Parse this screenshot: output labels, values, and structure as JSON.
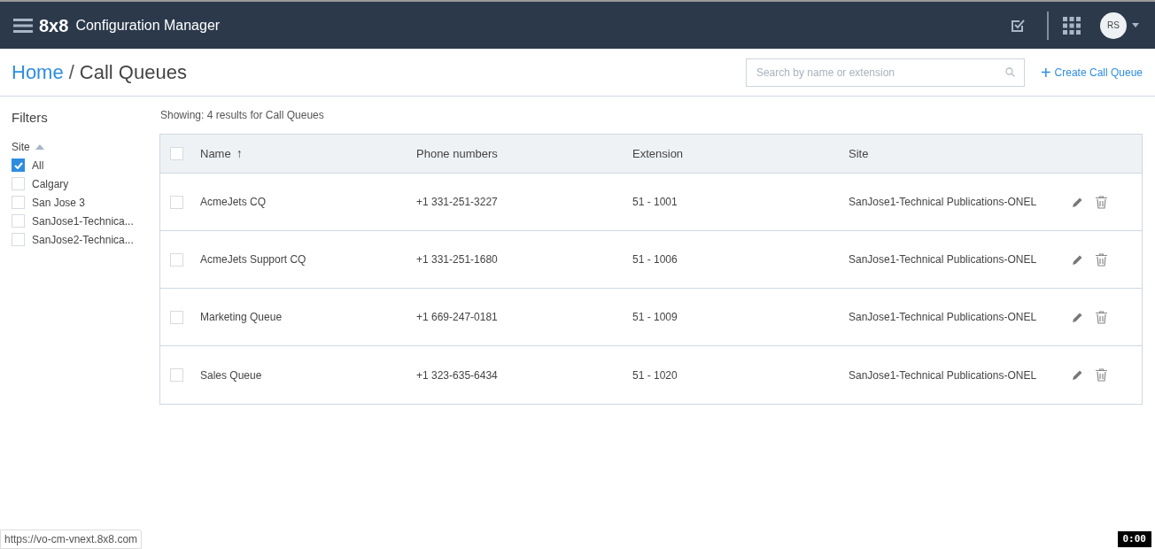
{
  "header": {
    "logo": "8x8",
    "app_title": "Configuration Manager",
    "avatar_initials": "RS"
  },
  "breadcrumb": {
    "home": "Home",
    "separator": "/",
    "current": "Call Queues"
  },
  "search": {
    "placeholder": "Search by name or extension"
  },
  "create_button": {
    "icon": "+",
    "label": "Create Call Queue"
  },
  "filters": {
    "title": "Filters",
    "group": "Site",
    "expanded": true,
    "items": [
      {
        "label": "All",
        "checked": true
      },
      {
        "label": "Calgary",
        "checked": false
      },
      {
        "label": "San Jose 3",
        "checked": false
      },
      {
        "label": "SanJose1-Technica...",
        "checked": false
      },
      {
        "label": "SanJose2-Technica...",
        "checked": false
      }
    ]
  },
  "results_summary": "Showing: 4 results for Call Queues",
  "table": {
    "select_all_checked": false,
    "columns": [
      {
        "label": "Name",
        "sort": "↑"
      },
      {
        "label": "Phone numbers"
      },
      {
        "label": "Extension"
      },
      {
        "label": "Site"
      }
    ],
    "rows": [
      {
        "checked": false,
        "cells": [
          "AcmeJets CQ",
          "+1 331-251-3227",
          "51 - 1001",
          "SanJose1-Technical Publications-ONEL"
        ]
      },
      {
        "checked": false,
        "cells": [
          "AcmeJets Support CQ",
          "+1 331-251-1680",
          "51 - 1006",
          "SanJose1-Technical Publications-ONEL"
        ]
      },
      {
        "checked": false,
        "cells": [
          "Marketing Queue",
          "+1 669-247-0181",
          "51 - 1009",
          "SanJose1-Technical Publications-ONEL"
        ]
      },
      {
        "checked": false,
        "cells": [
          "Sales Queue",
          "+1 323-635-6434",
          "51 - 1020",
          "SanJose1-Technical Publications-ONEL"
        ]
      }
    ]
  },
  "status_url": "https://vo-cm-vnext.8x8.com",
  "recorder_timer": "0:00"
}
